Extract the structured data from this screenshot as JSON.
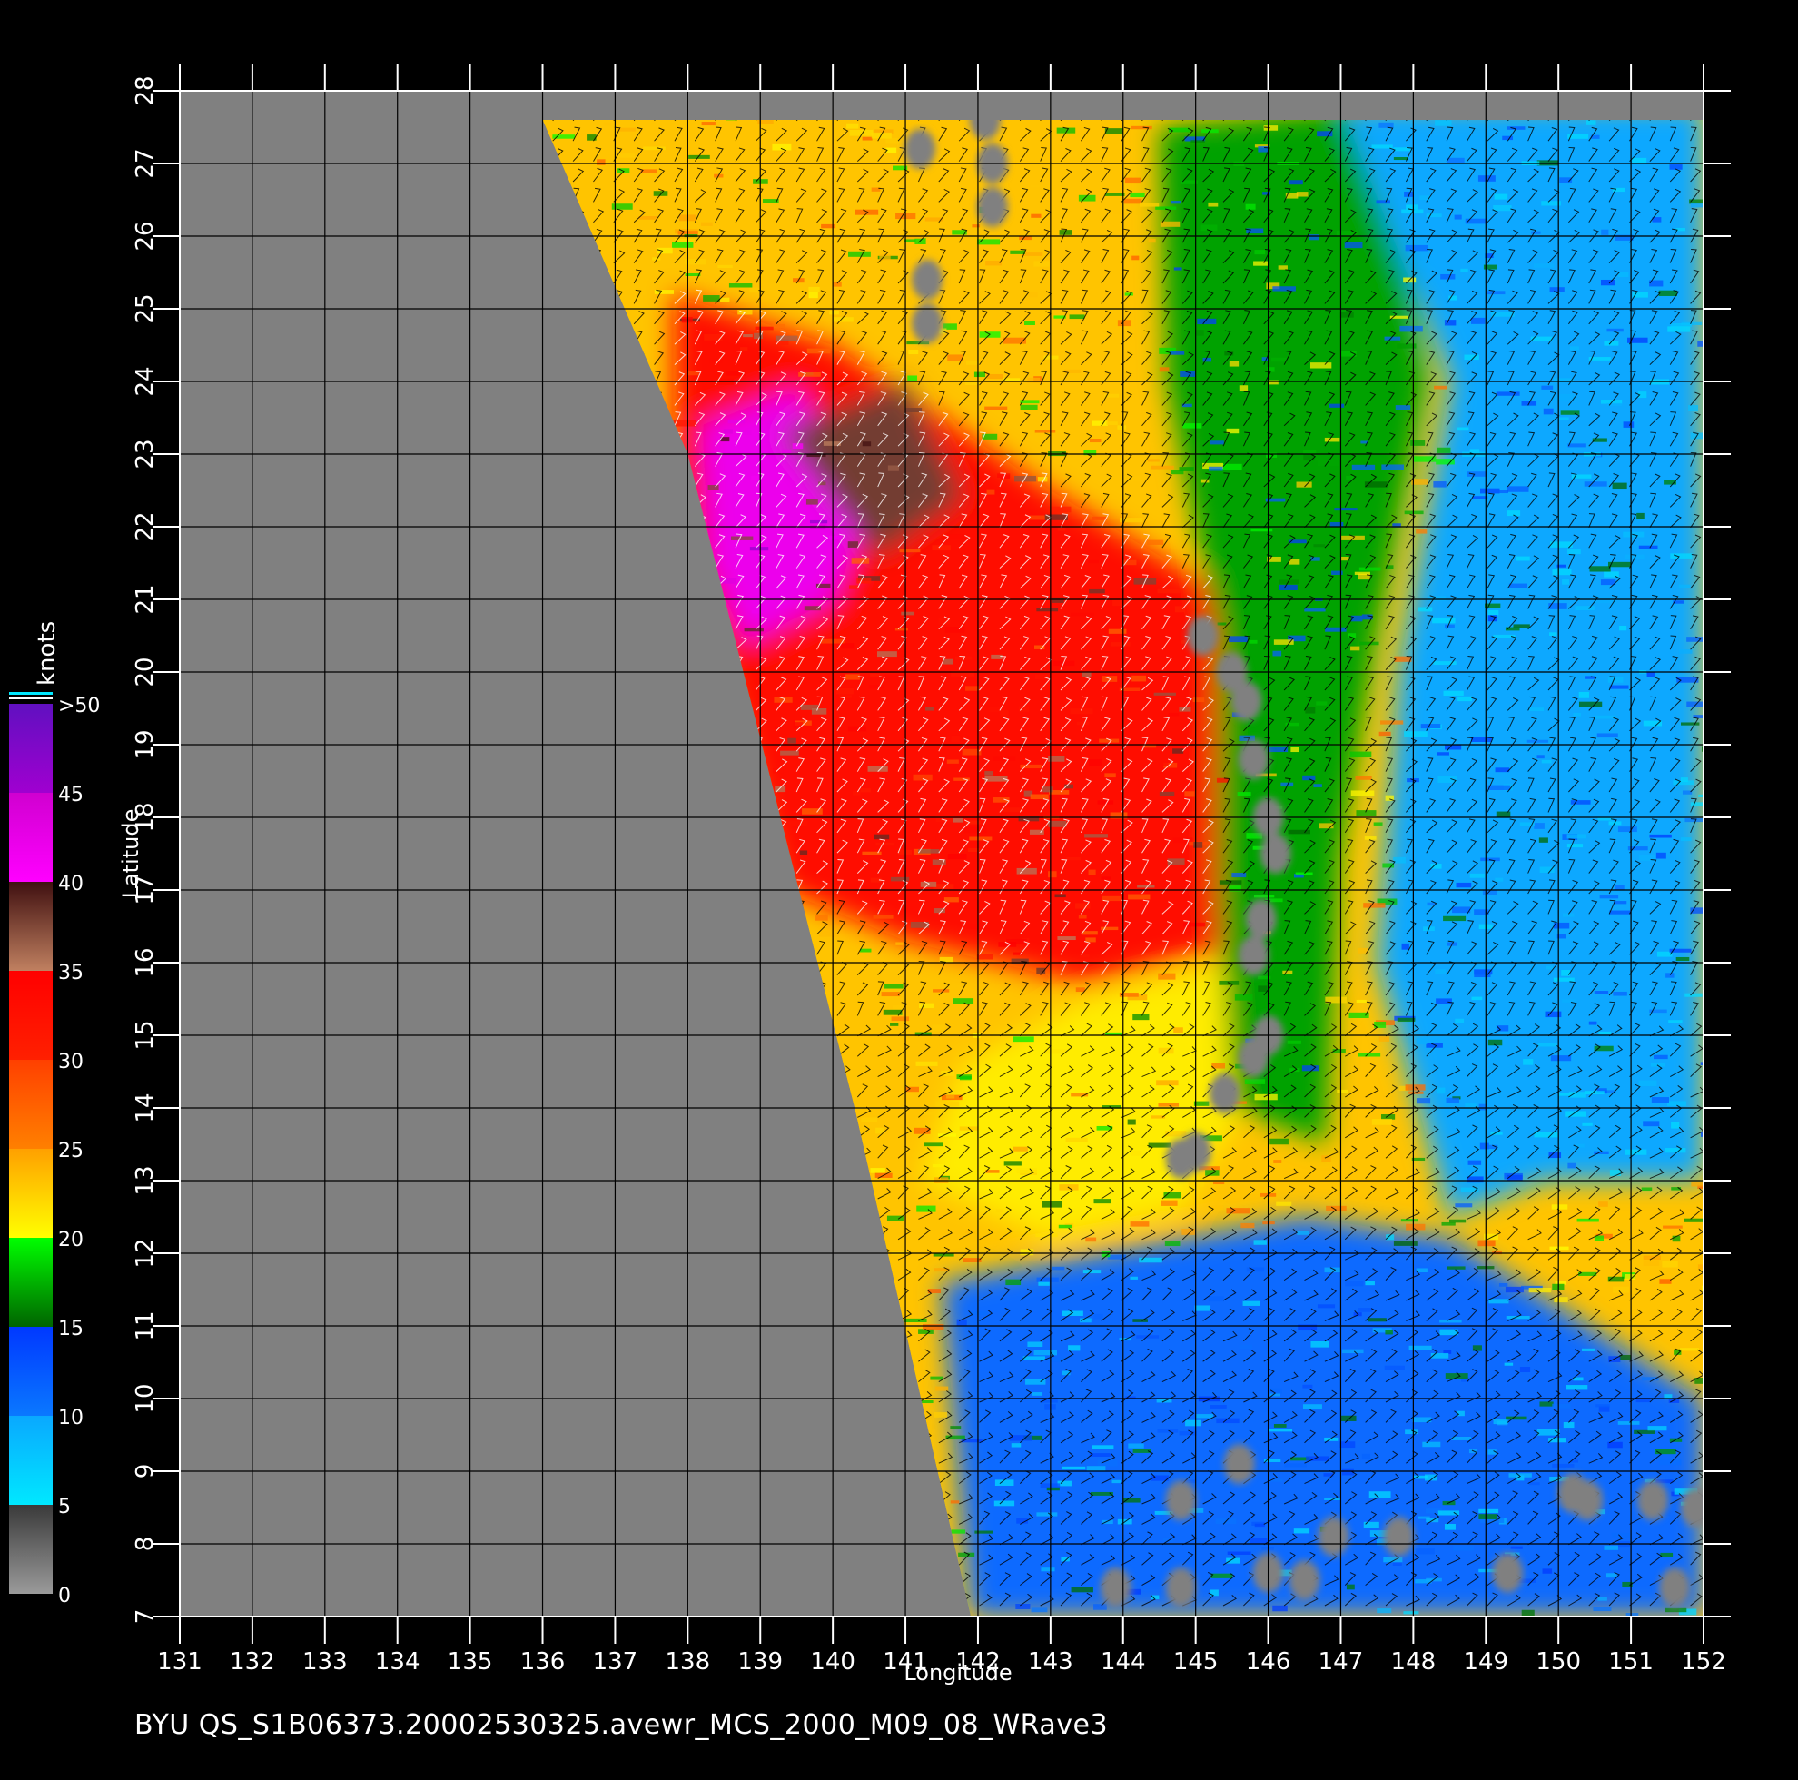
{
  "figure": {
    "xlabel": "Longitude",
    "ylabel": "Latitude",
    "footer": "BYU  QS_S1B06373.20002530325.avewr_MCS_2000_M09_08_WRave3",
    "lon_range": [
      131,
      152
    ],
    "lat_range": [
      7,
      28
    ],
    "lon_ticks": [
      "131",
      "132",
      "133",
      "134",
      "135",
      "136",
      "137",
      "138",
      "139",
      "140",
      "141",
      "142",
      "143",
      "144",
      "145",
      "146",
      "147",
      "148",
      "149",
      "150",
      "151",
      "152"
    ],
    "lat_ticks": [
      "7",
      "8",
      "9",
      "10",
      "11",
      "12",
      "13",
      "14",
      "15",
      "16",
      "17",
      "18",
      "19",
      "20",
      "21",
      "22",
      "23",
      "24",
      "25",
      "26",
      "27",
      "28"
    ],
    "grid": true
  },
  "colorbar": {
    "unit": "knots",
    "labels": [
      "0",
      "5",
      "10",
      "15",
      "20",
      "25",
      "30",
      "35",
      "40",
      "45",
      ">50"
    ],
    "bands": [
      {
        "from": 0,
        "to": 5,
        "colors": [
          "#9a9a9a",
          "#3a3a3a"
        ]
      },
      {
        "from": 5,
        "to": 10,
        "colors": [
          "#00e8ff",
          "#0aa8ff"
        ]
      },
      {
        "from": 10,
        "to": 15,
        "colors": [
          "#0a78ff",
          "#0038ff"
        ]
      },
      {
        "from": 15,
        "to": 20,
        "colors": [
          "#006400",
          "#00ff00"
        ]
      },
      {
        "from": 20,
        "to": 25,
        "colors": [
          "#ffff00",
          "#ffa000"
        ]
      },
      {
        "from": 25,
        "to": 30,
        "colors": [
          "#ff8000",
          "#ff4000"
        ]
      },
      {
        "from": 30,
        "to": 35,
        "colors": [
          "#ff2000",
          "#ff0000"
        ]
      },
      {
        "from": 35,
        "to": 40,
        "colors": [
          "#c08060",
          "#401010"
        ]
      },
      {
        "from": 40,
        "to": 45,
        "colors": [
          "#ff00ff",
          "#d000d0"
        ]
      },
      {
        "from": 45,
        "to": 50,
        "colors": [
          "#a000d0",
          "#6010c0"
        ]
      }
    ]
  },
  "colors": {
    "land_or_nodata": "#808080",
    "background": "#000000",
    "grid": "#000000",
    "axis": "#ffffff"
  },
  "swath": {
    "west_edge": [
      [
        136.0,
        27.6
      ],
      [
        138.0,
        23.0
      ],
      [
        140.3,
        14.0
      ],
      [
        141.9,
        7.0
      ]
    ]
  },
  "wind_regions": [
    {
      "name": "high-wind core",
      "speed_knots": 33,
      "polygon": [
        [
          137.8,
          25.2
        ],
        [
          140.0,
          24.5
        ],
        [
          143.0,
          22.5
        ],
        [
          145.5,
          21.0
        ],
        [
          146.0,
          18.5
        ],
        [
          145.7,
          16.3
        ],
        [
          143.5,
          15.7
        ],
        [
          141.0,
          16.3
        ],
        [
          139.3,
          17.0
        ],
        [
          138.5,
          20.0
        ],
        [
          137.8,
          22.0
        ]
      ]
    },
    {
      "name": "peak-wind band",
      "speed_knots": 42,
      "polygon": [
        [
          138.2,
          23.4
        ],
        [
          139.5,
          23.9
        ],
        [
          140.6,
          22.4
        ],
        [
          140.0,
          21.0
        ],
        [
          138.8,
          20.4
        ],
        [
          138.3,
          21.5
        ]
      ]
    },
    {
      "name": "gale band",
      "speed_knots": 38,
      "polygon": [
        [
          139.3,
          23.3
        ],
        [
          141.0,
          24.0
        ],
        [
          141.8,
          22.4
        ],
        [
          140.6,
          21.6
        ]
      ]
    },
    {
      "name": "moderate belt",
      "speed_knots": 21,
      "polygon": [
        [
          141.2,
          13.0
        ],
        [
          143.0,
          12.2
        ],
        [
          144.8,
          12.6
        ],
        [
          146.0,
          14.5
        ],
        [
          145.5,
          16.0
        ],
        [
          143.5,
          15.5
        ],
        [
          141.8,
          14.6
        ]
      ]
    },
    {
      "name": "trade-wind zone",
      "speed_knots": 17,
      "polygon": [
        [
          144.5,
          27.5
        ],
        [
          147.5,
          27.8
        ],
        [
          148.2,
          24.0
        ],
        [
          147.5,
          20.5
        ],
        [
          147.0,
          17.5
        ],
        [
          146.8,
          13.5
        ],
        [
          145.5,
          14.0
        ],
        [
          145.3,
          17.0
        ],
        [
          145.3,
          20.5
        ],
        [
          144.6,
          24.0
        ]
      ]
    },
    {
      "name": "southern light-wind zone",
      "speed_knots": 11,
      "polygon": [
        [
          141.5,
          11.6
        ],
        [
          146.5,
          12.5
        ],
        [
          148.5,
          12.2
        ],
        [
          152.0,
          10.0
        ],
        [
          152.0,
          7.0
        ],
        [
          141.9,
          7.0
        ]
      ]
    },
    {
      "name": "eastern light-wind zone",
      "speed_knots": 10,
      "polygon": [
        [
          147.0,
          27.8
        ],
        [
          152.0,
          27.8
        ],
        [
          152.0,
          13.0
        ],
        [
          149.8,
          13.0
        ],
        [
          148.5,
          12.5
        ],
        [
          147.5,
          16.0
        ],
        [
          147.8,
          20.0
        ],
        [
          148.5,
          24.0
        ]
      ]
    }
  ],
  "rain_flag_spots": [
    [
      142.1,
      27.6
    ],
    [
      142.2,
      27.0
    ],
    [
      142.2,
      26.4
    ],
    [
      141.2,
      27.2
    ],
    [
      141.3,
      25.4
    ],
    [
      141.3,
      24.8
    ],
    [
      145.1,
      20.5
    ],
    [
      145.5,
      20.0
    ],
    [
      145.7,
      19.6
    ],
    [
      145.8,
      18.8
    ],
    [
      146.0,
      18.0
    ],
    [
      146.1,
      17.5
    ],
    [
      145.9,
      16.6
    ],
    [
      145.8,
      16.1
    ],
    [
      146.0,
      15.0
    ],
    [
      145.8,
      14.7
    ],
    [
      145.4,
      14.2
    ],
    [
      145.0,
      13.4
    ],
    [
      144.8,
      13.3
    ],
    [
      145.6,
      9.1
    ],
    [
      144.8,
      8.6
    ],
    [
      143.9,
      7.4
    ],
    [
      144.8,
      7.4
    ],
    [
      146.0,
      7.6
    ],
    [
      146.5,
      7.5
    ],
    [
      146.9,
      8.1
    ],
    [
      147.8,
      8.1
    ],
    [
      149.3,
      7.6
    ],
    [
      150.2,
      8.7
    ],
    [
      150.4,
      8.6
    ],
    [
      151.3,
      8.6
    ],
    [
      151.9,
      8.5
    ],
    [
      151.6,
      7.4
    ]
  ]
}
